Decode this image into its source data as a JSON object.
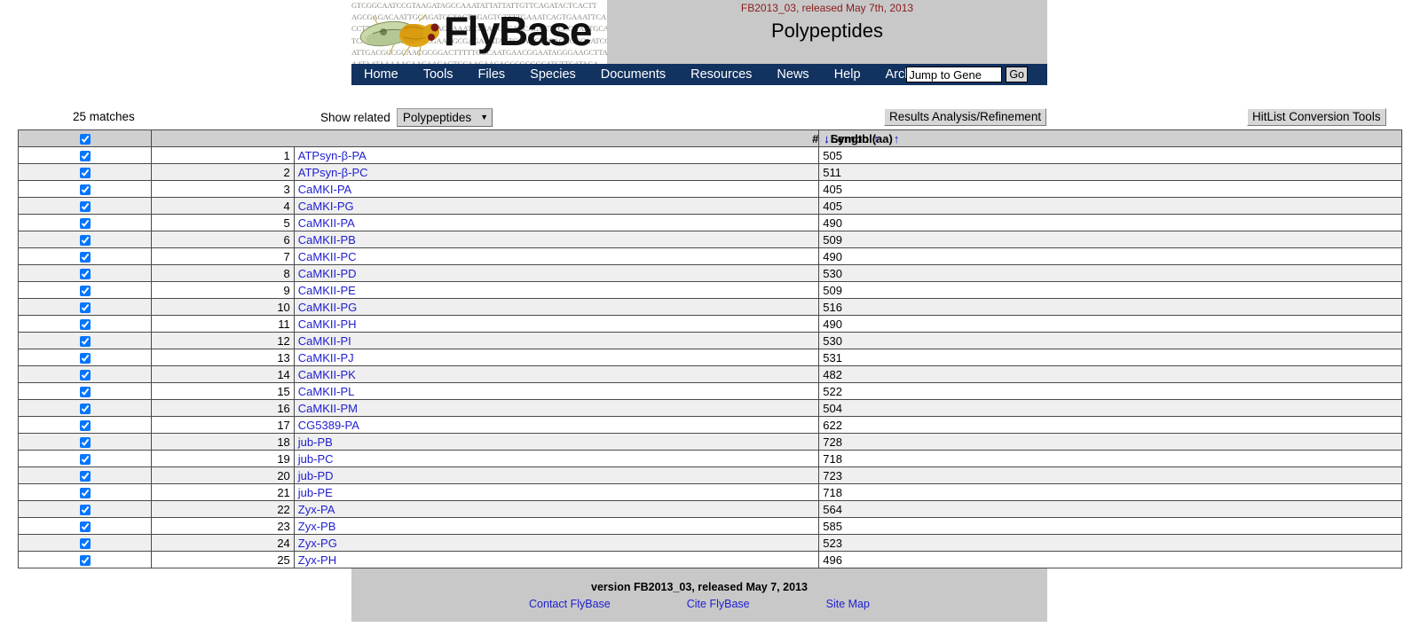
{
  "header": {
    "logo_text": "FlyBase",
    "release_note": "FB2013_03, released May 7th, 2013",
    "title": "Polypeptides",
    "dna_lines": [
      "GTCGGCAATCCGTAAGATAGCCAAATATTATTATTGTTCAGATACTCACTT",
      "AGCGAGACAATTGCAGATCGTACTGGAGTGTTTTGAAATCAGTGAAATTCA",
      "CCTTGAGGACAGTTGTAAGCAAATCTGAGGTCAACAGACTTCCGGAATGCA",
      "TCAGGCAGAATCCATCGAAAGCGAGAAATACTGGAAGTTCAGAGGCAATCC",
      "ATTGACGCCGCAACGCGGACTTTTTGGCAATGAACGGAATAGGGAAGCTTA",
      "AATAATAAAAACAACAACAGTGCAACAACAGCCGGGGCATCTTCATAGA"
    ]
  },
  "nav": {
    "items": [
      {
        "label": "Home",
        "name": "nav-item-home"
      },
      {
        "label": "Tools",
        "name": "nav-item-tools"
      },
      {
        "label": "Files",
        "name": "nav-item-files"
      },
      {
        "label": "Species",
        "name": "nav-item-species"
      },
      {
        "label": "Documents",
        "name": "nav-item-documents"
      },
      {
        "label": "Resources",
        "name": "nav-item-resources"
      },
      {
        "label": "News",
        "name": "nav-item-news"
      },
      {
        "label": "Help",
        "name": "nav-item-help"
      },
      {
        "label": "Archives",
        "name": "nav-item-archives"
      }
    ],
    "jump_placeholder": "Jump to Gene",
    "jump_value": "Jump to Gene",
    "go_label": "Go"
  },
  "toolbar": {
    "matches": "25 matches",
    "show_related_label": "Show related",
    "show_related_value": "Polypeptides",
    "show_related_options": [
      "Polypeptides"
    ],
    "results_analysis_label": "Results Analysis/Refinement",
    "hitlist_tools_label": "HitList Conversion Tools"
  },
  "table": {
    "headers": {
      "num": "#",
      "symbol": "Symbol",
      "length": "Length (aa)"
    },
    "sort_arrow_down": "↓",
    "sort_arrow_up": "↑",
    "rows": [
      {
        "num": "1",
        "symbol": "ATPsyn-β-PA",
        "length": "505"
      },
      {
        "num": "2",
        "symbol": "ATPsyn-β-PC",
        "length": "511"
      },
      {
        "num": "3",
        "symbol": "CaMKI-PA",
        "length": "405"
      },
      {
        "num": "4",
        "symbol": "CaMKI-PG",
        "length": "405"
      },
      {
        "num": "5",
        "symbol": "CaMKII-PA",
        "length": "490"
      },
      {
        "num": "6",
        "symbol": "CaMKII-PB",
        "length": "509"
      },
      {
        "num": "7",
        "symbol": "CaMKII-PC",
        "length": "490"
      },
      {
        "num": "8",
        "symbol": "CaMKII-PD",
        "length": "530"
      },
      {
        "num": "9",
        "symbol": "CaMKII-PE",
        "length": "509"
      },
      {
        "num": "10",
        "symbol": "CaMKII-PG",
        "length": "516"
      },
      {
        "num": "11",
        "symbol": "CaMKII-PH",
        "length": "490"
      },
      {
        "num": "12",
        "symbol": "CaMKII-PI",
        "length": "530"
      },
      {
        "num": "13",
        "symbol": "CaMKII-PJ",
        "length": "531"
      },
      {
        "num": "14",
        "symbol": "CaMKII-PK",
        "length": "482"
      },
      {
        "num": "15",
        "symbol": "CaMKII-PL",
        "length": "522"
      },
      {
        "num": "16",
        "symbol": "CaMKII-PM",
        "length": "504"
      },
      {
        "num": "17",
        "symbol": "CG5389-PA",
        "length": "622"
      },
      {
        "num": "18",
        "symbol": "jub-PB",
        "length": "728"
      },
      {
        "num": "19",
        "symbol": "jub-PC",
        "length": "718"
      },
      {
        "num": "20",
        "symbol": "jub-PD",
        "length": "723"
      },
      {
        "num": "21",
        "symbol": "jub-PE",
        "length": "718"
      },
      {
        "num": "22",
        "symbol": "Zyx-PA",
        "length": "564"
      },
      {
        "num": "23",
        "symbol": "Zyx-PB",
        "length": "585"
      },
      {
        "num": "24",
        "symbol": "Zyx-PG",
        "length": "523"
      },
      {
        "num": "25",
        "symbol": "Zyx-PH",
        "length": "496"
      }
    ]
  },
  "footer": {
    "version": "version FB2013_03, released May 7, 2013",
    "links": [
      {
        "label": "Contact FlyBase",
        "name": "footer-link-contact-flybase"
      },
      {
        "label": "Cite FlyBase",
        "name": "footer-link-cite-flybase"
      },
      {
        "label": "Site Map",
        "name": "footer-link-site-map"
      }
    ]
  },
  "colors": {
    "nav_bar": "#123260",
    "header_bg": "#c8c8c8",
    "link": "#2020d0",
    "release_text": "#8b1a1a",
    "sort_arrow": "#1414c8"
  }
}
